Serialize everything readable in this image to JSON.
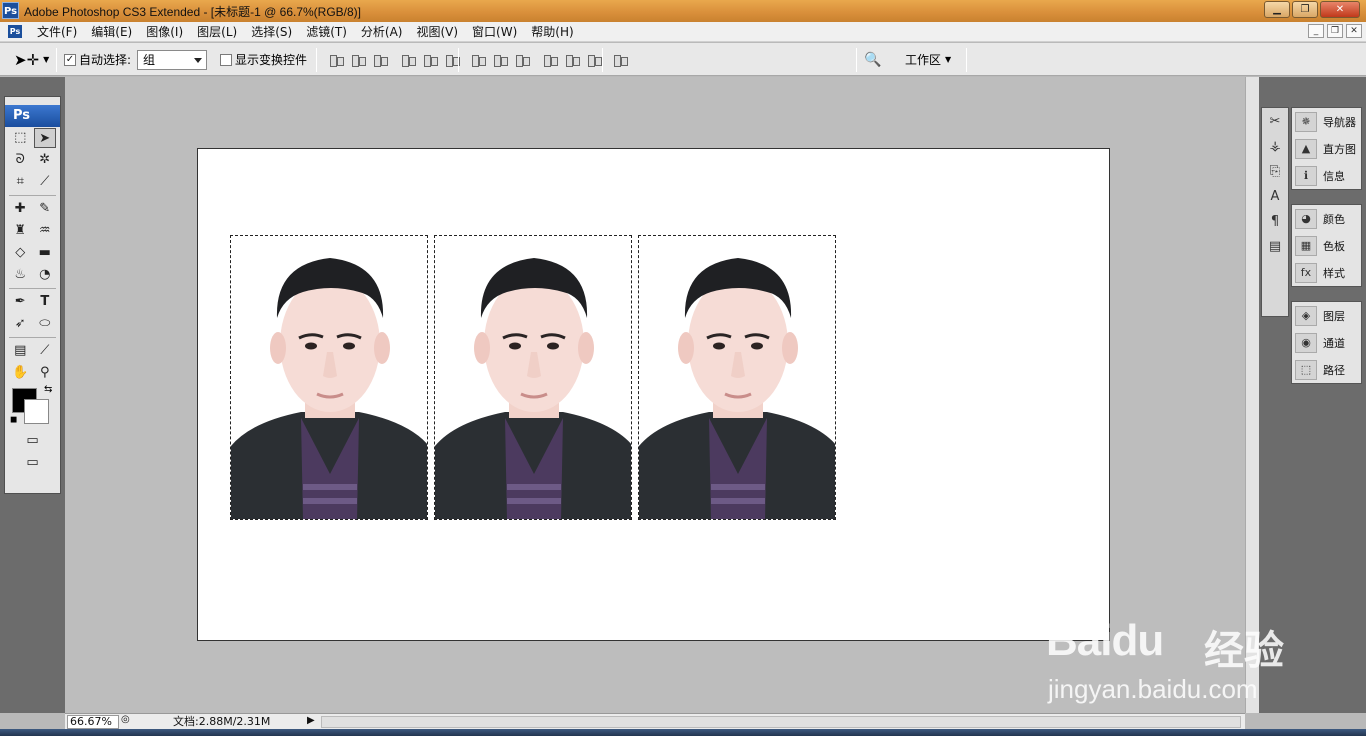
{
  "window": {
    "title": "Adobe Photoshop CS3 Extended - [未标题-1 @ 66.7%(RGB/8)]",
    "app_logo": "Ps",
    "buttons": [
      "minimize-icon",
      "maximize-icon",
      "close-icon"
    ]
  },
  "menu": {
    "items": [
      "文件(F)",
      "编辑(E)",
      "图像(I)",
      "图层(L)",
      "选择(S)",
      "滤镜(T)",
      "分析(A)",
      "视图(V)",
      "窗口(W)",
      "帮助(H)"
    ]
  },
  "options": {
    "auto_select_label": "自动选择:",
    "auto_select_checked": true,
    "auto_select_value": "组",
    "show_transform_label": "显示变换控件",
    "show_transform_checked": false,
    "workspace_label": "工作区"
  },
  "toolbox": {
    "logo": "Ps",
    "foreground_color": "#000000",
    "background_color": "#ffffff"
  },
  "document": {
    "background": "#ffffff",
    "photo_count": 3
  },
  "panels": {
    "group1": [
      "导航器",
      "直方图",
      "信息"
    ],
    "group2": [
      "颜色",
      "色板",
      "样式"
    ],
    "group3": [
      "图层",
      "通道",
      "路径"
    ]
  },
  "status": {
    "zoom": "66.67%",
    "doc_info": "文档:2.88M/2.31M"
  },
  "watermark": {
    "brand": "Baidu",
    "cn": "经验",
    "url": "jingyan.baidu.com"
  },
  "colors": {
    "titlebar": "#d88e3a",
    "ps_blue": "#1b4f9c",
    "canvas_gray": "#bdbdbd"
  }
}
